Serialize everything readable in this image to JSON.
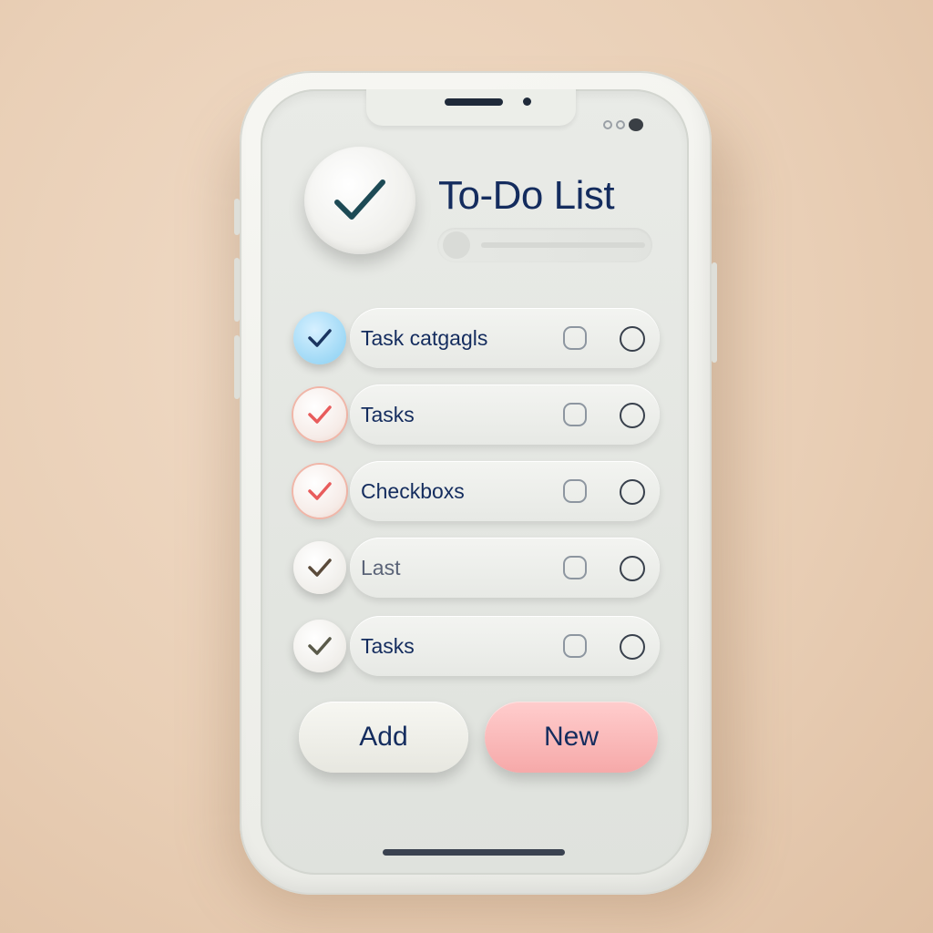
{
  "app": {
    "title": "To-Do List"
  },
  "tasks": [
    {
      "label": "Task catgagls",
      "check_color": "#8fd0f2",
      "style": "blue"
    },
    {
      "label": "Tasks",
      "check_color": "#e85c5c",
      "style": "red"
    },
    {
      "label": "Checkboxs",
      "check_color": "#e85c5c",
      "style": "red"
    },
    {
      "label": "Last",
      "check_color": "#5a4a3a",
      "style": "plain"
    },
    {
      "label": "Tasks",
      "check_color": "#5a5a4a",
      "style": "plain"
    }
  ],
  "buttons": {
    "add_label": "Add",
    "new_label": "New"
  },
  "icons": {
    "header": "checkmark-icon",
    "row_check": "checkmark-icon",
    "row_square": "square-outline-icon",
    "row_circle": "circle-outline-icon"
  },
  "colors": {
    "title_text": "#142c5e",
    "new_button": "#f6a9a9",
    "add_button": "#efefe9",
    "background": "#ecd5bf"
  }
}
